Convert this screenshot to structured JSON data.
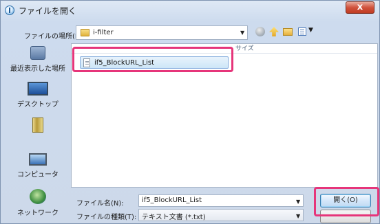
{
  "window": {
    "title": "ファイルを開く",
    "close_label": "x"
  },
  "lookin": {
    "label": "ファイルの場所(I):",
    "value": "i-filter"
  },
  "places": [
    {
      "label": "最近表示した場所",
      "icon": "recent-places-icon"
    },
    {
      "label": "デスクトップ",
      "icon": "desktop-icon"
    },
    {
      "label": "",
      "icon": "documents-folder-icon"
    },
    {
      "label": "コンピュータ",
      "icon": "computer-icon"
    },
    {
      "label": "ネットワーク",
      "icon": "network-icon"
    }
  ],
  "file_list": {
    "size_header": "サイズ",
    "files": [
      {
        "name": "if5_BlockURL_List"
      }
    ]
  },
  "filename": {
    "label": "ファイル名(N):",
    "value": "if5_BlockURL_List"
  },
  "filetype": {
    "label": "ファイルの種類(T):",
    "value": "テキスト文書 (*.txt)"
  },
  "buttons": {
    "open": "開く(O)"
  },
  "colors": {
    "highlight": "#e6357a",
    "accent": "#3c7fb1"
  }
}
